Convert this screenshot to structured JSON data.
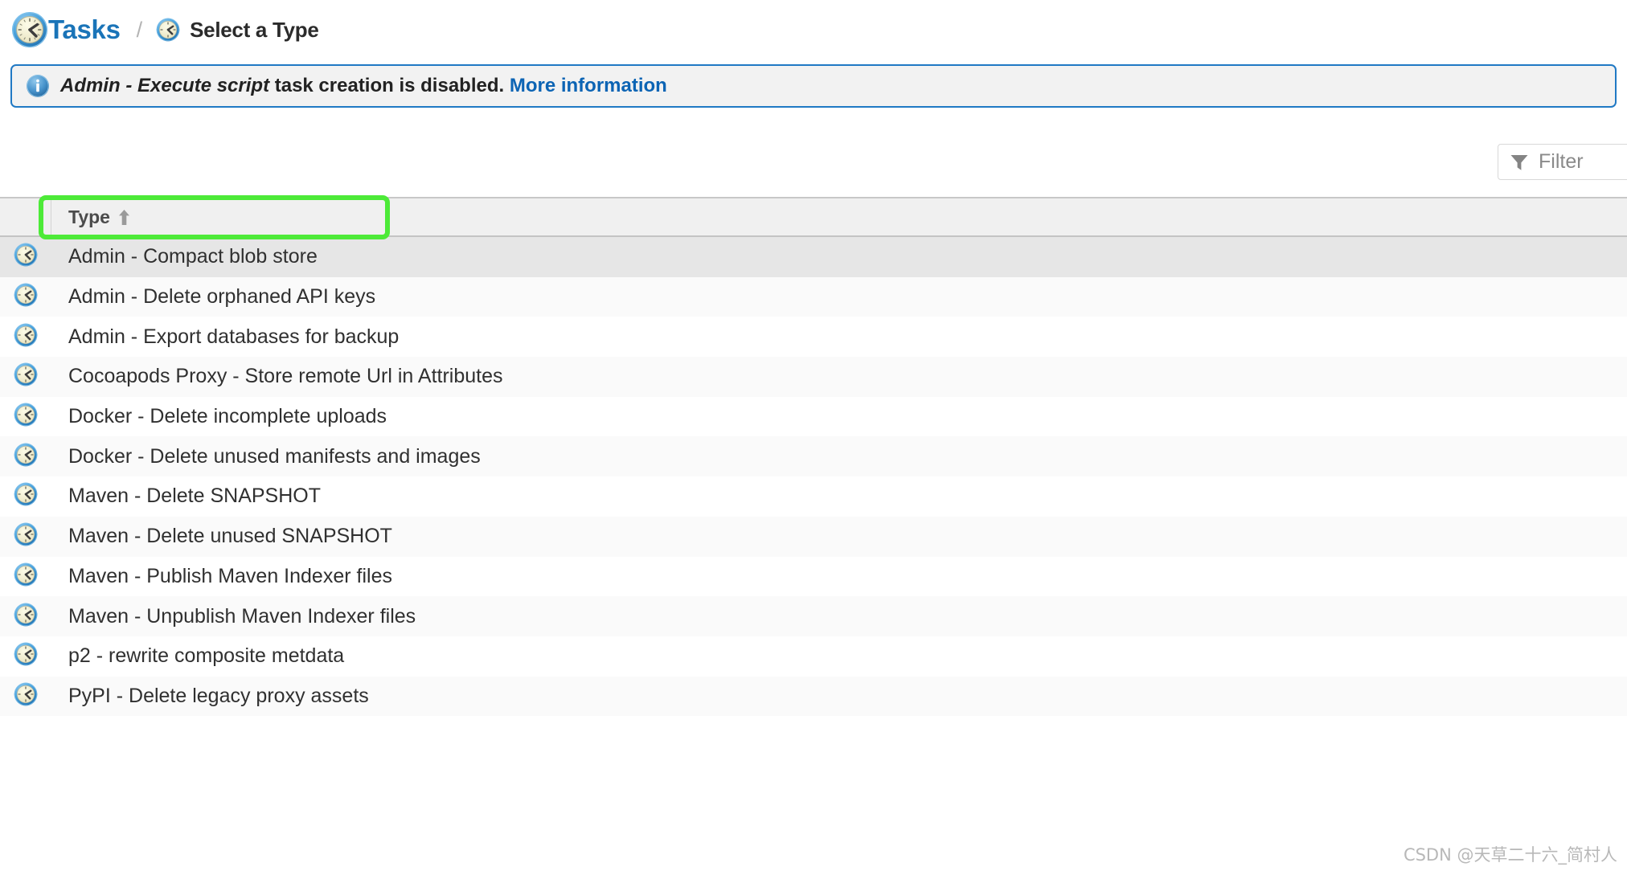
{
  "breadcrumb": {
    "root": {
      "label": "Tasks",
      "icon": "clock-icon"
    },
    "separator": "/",
    "current": {
      "label": "Select a Type",
      "icon": "clock-icon"
    }
  },
  "banner": {
    "icon": "info-icon",
    "emphasis": "Admin - Execute script",
    "message": " task creation is disabled. ",
    "link": "More information",
    "border_color": "#2079c4",
    "background_color": "#f2f2f2",
    "link_color": "#0c64b4"
  },
  "toolbar": {
    "filter": {
      "icon": "filter-funnel-icon",
      "value": "",
      "placeholder": "Filter"
    }
  },
  "table": {
    "columns": [
      {
        "key": "icon",
        "label": ""
      },
      {
        "key": "type",
        "label": "Type",
        "sort": "ascending",
        "sort_glyph": "↑"
      }
    ],
    "rows": [
      {
        "icon": "clock-icon",
        "type": "Admin - Compact blob store"
      },
      {
        "icon": "clock-icon",
        "type": "Admin - Delete orphaned API keys"
      },
      {
        "icon": "clock-icon",
        "type": "Admin - Export databases for backup"
      },
      {
        "icon": "clock-icon",
        "type": "Cocoapods Proxy - Store remote Url in Attributes"
      },
      {
        "icon": "clock-icon",
        "type": "Docker - Delete incomplete uploads"
      },
      {
        "icon": "clock-icon",
        "type": "Docker - Delete unused manifests and images"
      },
      {
        "icon": "clock-icon",
        "type": "Maven - Delete SNAPSHOT"
      },
      {
        "icon": "clock-icon",
        "type": "Maven - Delete unused SNAPSHOT"
      },
      {
        "icon": "clock-icon",
        "type": "Maven - Publish Maven Indexer files"
      },
      {
        "icon": "clock-icon",
        "type": "Maven - Unpublish Maven Indexer files"
      },
      {
        "icon": "clock-icon",
        "type": "p2 - rewrite composite metdata"
      },
      {
        "icon": "clock-icon",
        "type": "PyPI - Delete legacy proxy assets"
      }
    ],
    "selected_row_index": 0,
    "highlight_color": "#4dea38"
  },
  "watermark": {
    "text": "CSDN @天草二十六_简村人"
  }
}
